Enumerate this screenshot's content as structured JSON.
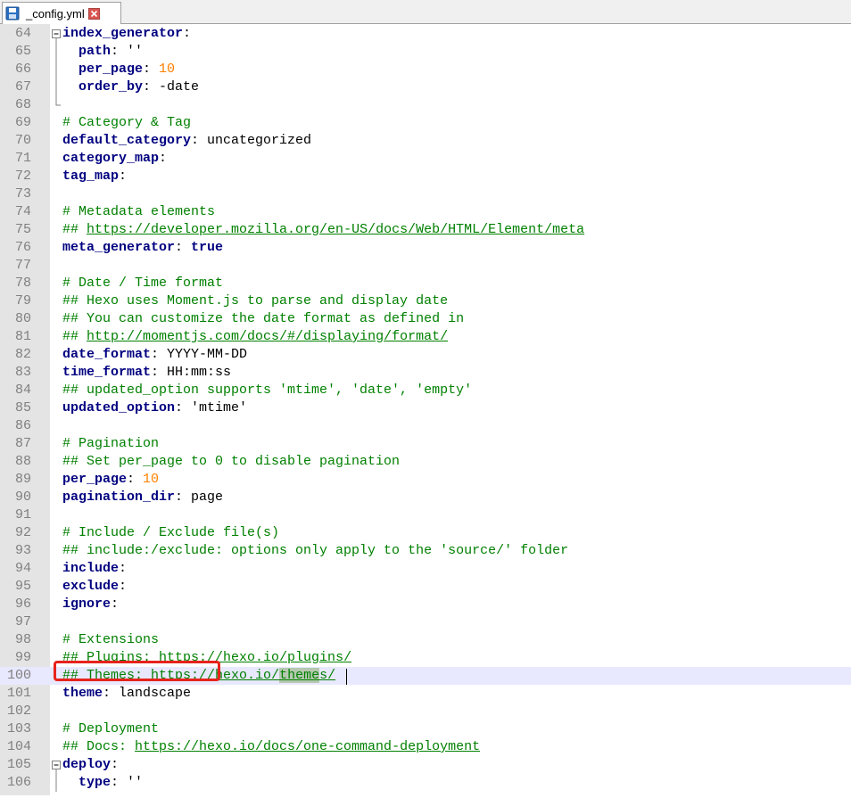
{
  "tab": {
    "label": "_config.yml"
  },
  "lines": [
    {
      "n": "64",
      "segs": [
        {
          "t": "index_generator",
          "c": "k"
        },
        {
          "t": ":",
          "c": "v"
        }
      ]
    },
    {
      "n": "65",
      "segs": [
        {
          "t": "  path",
          "c": "k"
        },
        {
          "t": ": ''",
          "c": "v"
        }
      ]
    },
    {
      "n": "66",
      "segs": [
        {
          "t": "  per_page",
          "c": "k"
        },
        {
          "t": ": ",
          "c": "v"
        },
        {
          "t": "10",
          "c": "n"
        }
      ]
    },
    {
      "n": "67",
      "segs": [
        {
          "t": "  order_by",
          "c": "k"
        },
        {
          "t": ": -date",
          "c": "v"
        }
      ]
    },
    {
      "n": "68",
      "segs": []
    },
    {
      "n": "69",
      "segs": [
        {
          "t": "# Category & Tag",
          "c": "c"
        }
      ]
    },
    {
      "n": "70",
      "segs": [
        {
          "t": "default_category",
          "c": "k"
        },
        {
          "t": ": uncategorized",
          "c": "v"
        }
      ]
    },
    {
      "n": "71",
      "segs": [
        {
          "t": "category_map",
          "c": "k"
        },
        {
          "t": ":",
          "c": "v"
        }
      ]
    },
    {
      "n": "72",
      "segs": [
        {
          "t": "tag_map",
          "c": "k"
        },
        {
          "t": ":",
          "c": "v"
        }
      ]
    },
    {
      "n": "73",
      "segs": []
    },
    {
      "n": "74",
      "segs": [
        {
          "t": "# Metadata elements",
          "c": "c"
        }
      ]
    },
    {
      "n": "75",
      "segs": [
        {
          "t": "## ",
          "c": "c"
        },
        {
          "t": "https://developer.mozilla.org/en-US/docs/Web/HTML/Element/meta",
          "c": "u"
        }
      ]
    },
    {
      "n": "76",
      "segs": [
        {
          "t": "meta_generator",
          "c": "k"
        },
        {
          "t": ": ",
          "c": "v"
        },
        {
          "t": "true",
          "c": "b"
        }
      ]
    },
    {
      "n": "77",
      "segs": []
    },
    {
      "n": "78",
      "segs": [
        {
          "t": "# Date / Time format",
          "c": "c"
        }
      ]
    },
    {
      "n": "79",
      "segs": [
        {
          "t": "## Hexo uses Moment.js to parse and display date",
          "c": "c"
        }
      ]
    },
    {
      "n": "80",
      "segs": [
        {
          "t": "## You can customize the date format as defined in",
          "c": "c"
        }
      ]
    },
    {
      "n": "81",
      "segs": [
        {
          "t": "## ",
          "c": "c"
        },
        {
          "t": "http://momentjs.com/docs/#/displaying/format/",
          "c": "u"
        }
      ]
    },
    {
      "n": "82",
      "segs": [
        {
          "t": "date_format",
          "c": "k"
        },
        {
          "t": ": YYYY-MM-DD",
          "c": "v"
        }
      ]
    },
    {
      "n": "83",
      "segs": [
        {
          "t": "time_format",
          "c": "k"
        },
        {
          "t": ": HH:mm:ss",
          "c": "v"
        }
      ]
    },
    {
      "n": "84",
      "segs": [
        {
          "t": "## updated_option supports 'mtime', 'date', 'empty'",
          "c": "c"
        }
      ]
    },
    {
      "n": "85",
      "segs": [
        {
          "t": "updated_option",
          "c": "k"
        },
        {
          "t": ": 'mtime'",
          "c": "v"
        }
      ]
    },
    {
      "n": "86",
      "segs": []
    },
    {
      "n": "87",
      "segs": [
        {
          "t": "# Pagination",
          "c": "c"
        }
      ]
    },
    {
      "n": "88",
      "segs": [
        {
          "t": "## Set per_page to 0 to disable pagination",
          "c": "c"
        }
      ]
    },
    {
      "n": "89",
      "segs": [
        {
          "t": "per_page",
          "c": "k"
        },
        {
          "t": ": ",
          "c": "v"
        },
        {
          "t": "10",
          "c": "n"
        }
      ]
    },
    {
      "n": "90",
      "segs": [
        {
          "t": "pagination_dir",
          "c": "k"
        },
        {
          "t": ": page",
          "c": "v"
        }
      ]
    },
    {
      "n": "91",
      "segs": []
    },
    {
      "n": "92",
      "segs": [
        {
          "t": "# Include / Exclude file(s)",
          "c": "c"
        }
      ]
    },
    {
      "n": "93",
      "segs": [
        {
          "t": "## include:/exclude: options only apply to the 'source/' folder",
          "c": "c"
        }
      ]
    },
    {
      "n": "94",
      "segs": [
        {
          "t": "include",
          "c": "k"
        },
        {
          "t": ":",
          "c": "v"
        }
      ]
    },
    {
      "n": "95",
      "segs": [
        {
          "t": "exclude",
          "c": "k"
        },
        {
          "t": ":",
          "c": "v"
        }
      ]
    },
    {
      "n": "96",
      "segs": [
        {
          "t": "ignore",
          "c": "k"
        },
        {
          "t": ":",
          "c": "v"
        }
      ]
    },
    {
      "n": "97",
      "segs": []
    },
    {
      "n": "98",
      "segs": [
        {
          "t": "# Extensions",
          "c": "c"
        }
      ]
    },
    {
      "n": "99",
      "segs": [
        {
          "t": "## Plugins: ",
          "c": "c"
        },
        {
          "t": "https://hexo.io/plugins/",
          "c": "u"
        }
      ]
    },
    {
      "n": "100",
      "cur": true,
      "segs": [
        {
          "t": "## Themes: ",
          "c": "c"
        },
        {
          "t": "https://hexo.io/",
          "c": "u"
        },
        {
          "t": "theme",
          "c": "u hl"
        },
        {
          "t": "s/",
          "c": "u"
        }
      ]
    },
    {
      "n": "101",
      "segs": [
        {
          "t": "theme",
          "c": "k"
        },
        {
          "t": ": landscape",
          "c": "v"
        }
      ]
    },
    {
      "n": "102",
      "segs": []
    },
    {
      "n": "103",
      "segs": [
        {
          "t": "# Deployment",
          "c": "c"
        }
      ]
    },
    {
      "n": "104",
      "segs": [
        {
          "t": "## Docs: ",
          "c": "c"
        },
        {
          "t": "https://hexo.io/docs/one-command-deployment",
          "c": "u"
        }
      ]
    },
    {
      "n": "105",
      "segs": [
        {
          "t": "deploy",
          "c": "k"
        },
        {
          "t": ":",
          "c": "v"
        }
      ]
    },
    {
      "n": "106",
      "segs": [
        {
          "t": "  type",
          "c": "k"
        },
        {
          "t": ": ''",
          "c": "v"
        }
      ]
    }
  ]
}
